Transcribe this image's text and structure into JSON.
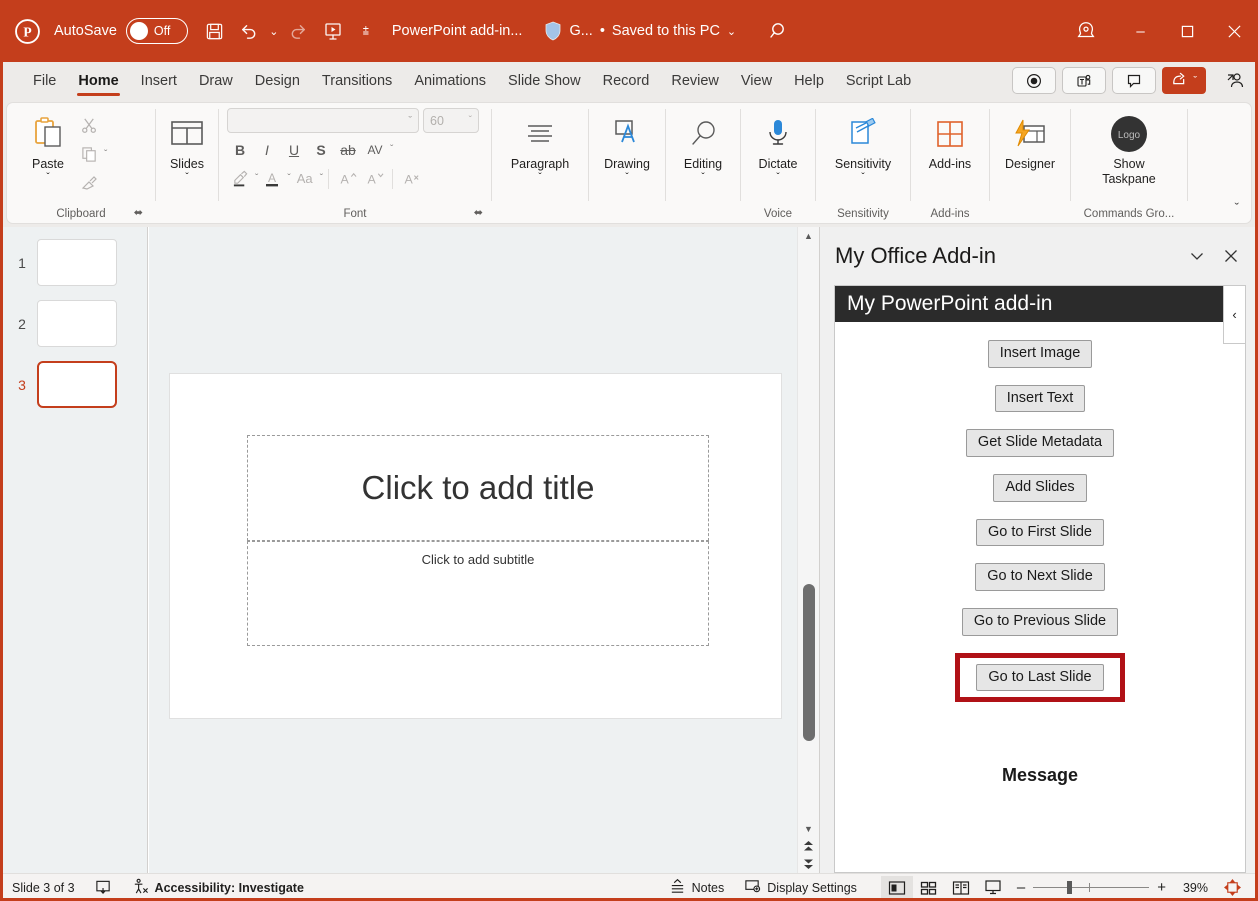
{
  "titlebar": {
    "app_icon": "powerpoint-logo-icon",
    "autosave_label": "AutoSave",
    "autosave_state": "Off",
    "save_icon": "save-icon",
    "undo_icon": "undo-icon",
    "redo_icon": "redo-icon",
    "present_icon": "start-presentation-icon",
    "qat_more_icon": "quick-access-more-icon",
    "document_title": "PowerPoint add-in...",
    "shield_icon": "sensitivity-shield-icon",
    "sensitivity_label": "G...",
    "separator": "•",
    "save_state": "Saved to this PC",
    "search_icon": "search-icon",
    "copilot_icon": "copilot-icon",
    "minimize_label": "–",
    "maximize_label": "☐",
    "close_label": "×",
    "accent_color": "#c43e1c"
  },
  "tabs": [
    {
      "label": "File",
      "active": false
    },
    {
      "label": "Home",
      "active": true
    },
    {
      "label": "Insert",
      "active": false
    },
    {
      "label": "Draw",
      "active": false
    },
    {
      "label": "Design",
      "active": false
    },
    {
      "label": "Transitions",
      "active": false
    },
    {
      "label": "Animations",
      "active": false
    },
    {
      "label": "Slide Show",
      "active": false
    },
    {
      "label": "Record",
      "active": false
    },
    {
      "label": "Review",
      "active": false
    },
    {
      "label": "View",
      "active": false
    },
    {
      "label": "Help",
      "active": false
    },
    {
      "label": "Script Lab",
      "active": false
    }
  ],
  "tabstrip_right": {
    "record_icon": "record-button-icon",
    "teams_icon": "present-in-teams-icon",
    "comments_icon": "comments-icon",
    "share_label": "",
    "share_icon": "share-icon",
    "share_chevron": "ˇ",
    "person_icon": "share-person-icon"
  },
  "ribbon": {
    "groups": [
      {
        "name": "clipboard",
        "label": "Clipboard",
        "paste": {
          "label": "Paste",
          "icon": "paste-icon",
          "chevron": "ˇ"
        },
        "cut": {
          "icon": "cut-scissors-icon"
        },
        "copy": {
          "icon": "copy-icon",
          "chevron": "ˇ"
        },
        "format_painter": {
          "icon": "format-painter-icon"
        },
        "launcher": "⬌"
      },
      {
        "name": "slides",
        "label": "",
        "slides": {
          "label": "Slides",
          "icon": "slide-layout-icon",
          "chevron": "ˇ"
        }
      },
      {
        "name": "font",
        "label": "Font",
        "font_name": {
          "value": "",
          "chevron": "ˇ"
        },
        "font_size": {
          "value": "60",
          "chevron": "ˇ"
        },
        "bold": "B",
        "italic": "I",
        "underline": "U",
        "shadow": "S",
        "strikethrough": "ab",
        "char_spacing": "AV",
        "text_highlight": {
          "icon": "text-highlight-icon",
          "chevron": "ˇ"
        },
        "font_color": {
          "icon": "font-color-icon",
          "chevron": "ˇ"
        },
        "change_case": {
          "label": "Aa",
          "chevron": "ˇ"
        },
        "increase_size": "A",
        "decrease_size": "A",
        "clear_formatting": {
          "icon": "clear-formatting-icon"
        },
        "launcher": "⬌"
      },
      {
        "name": "paragraph",
        "label": "",
        "paragraph": {
          "label": "Paragraph",
          "icon": "paragraph-align-icon",
          "chevron": "ˇ"
        }
      },
      {
        "name": "drawing",
        "label": "",
        "drawing": {
          "label": "Drawing",
          "icon": "drawing-shape-icon",
          "chevron": "ˇ"
        }
      },
      {
        "name": "editing",
        "label": "",
        "editing": {
          "label": "Editing",
          "icon": "editing-search-icon",
          "chevron": "ˇ"
        }
      },
      {
        "name": "voice",
        "label": "Voice",
        "dictate": {
          "label": "Dictate",
          "icon": "microphone-icon",
          "chevron": "ˇ"
        }
      },
      {
        "name": "sensitivity",
        "label": "Sensitivity",
        "sensitivity": {
          "label": "Sensitivity",
          "icon": "sensitivity-icon",
          "chevron": "ˇ"
        }
      },
      {
        "name": "addins",
        "label": "Add-ins",
        "addins": {
          "label": "Add-ins",
          "icon": "addins-grid-icon"
        }
      },
      {
        "name": "designer",
        "label": "",
        "designer": {
          "label": "Designer",
          "icon": "designer-icon"
        }
      },
      {
        "name": "commands",
        "label": "Commands Gro...",
        "show_taskpane": {
          "label": "Show\nTaskpane",
          "label_line1": "Show",
          "label_line2": "Taskpane",
          "icon": "logo-badge-icon",
          "icon_text": "Logo"
        }
      }
    ],
    "collapse_ribbon_chevron": "ˇ"
  },
  "thumbnails": {
    "slides": [
      {
        "number": "1",
        "selected": false
      },
      {
        "number": "2",
        "selected": false
      },
      {
        "number": "3",
        "selected": true
      }
    ]
  },
  "slide_canvas": {
    "title_placeholder": "Click to add title",
    "subtitle_placeholder": "Click to add subtitle"
  },
  "scrollbar": {
    "up_arrow": "▲",
    "down_arrow": "▼",
    "prev_slide_icon": "previous-slide-double-arrow-icon",
    "next_slide_icon": "next-slide-double-arrow-icon"
  },
  "taskpane": {
    "title": "My Office Add-in",
    "collapse_chevron": "ˇ",
    "close_label": "✕",
    "addin_header": "My PowerPoint add-in",
    "side_collapse_chevron": "‹",
    "buttons": [
      {
        "label": "Insert Image",
        "highlighted": false
      },
      {
        "label": "Insert Text",
        "highlighted": false
      },
      {
        "label": "Get Slide Metadata",
        "highlighted": false
      },
      {
        "label": "Add Slides",
        "highlighted": false
      },
      {
        "label": "Go to First Slide",
        "highlighted": false
      },
      {
        "label": "Go to Next Slide",
        "highlighted": false
      },
      {
        "label": "Go to Previous Slide",
        "highlighted": false
      },
      {
        "label": "Go to Last Slide",
        "highlighted": true
      }
    ],
    "message_heading": "Message",
    "highlight_color": "#b01116"
  },
  "statusbar": {
    "slide_count": "Slide 3 of 3",
    "notes_check_icon": "slide-notes-icon",
    "accessibility_icon": "accessibility-icon",
    "accessibility_label": "Accessibility: Investigate",
    "notes_icon": "notes-icon",
    "notes_label": "Notes",
    "display_settings_icon": "display-settings-icon",
    "display_settings_label": "Display Settings",
    "view_normal_icon": "view-normal-icon",
    "view_sorter_icon": "view-slide-sorter-icon",
    "view_reading_icon": "view-reading-icon",
    "view_slideshow_icon": "view-slideshow-icon",
    "zoom_out": "–",
    "zoom_in": "+",
    "zoom_level": "39%",
    "fit_slide_icon": "fit-slide-to-window-icon"
  }
}
